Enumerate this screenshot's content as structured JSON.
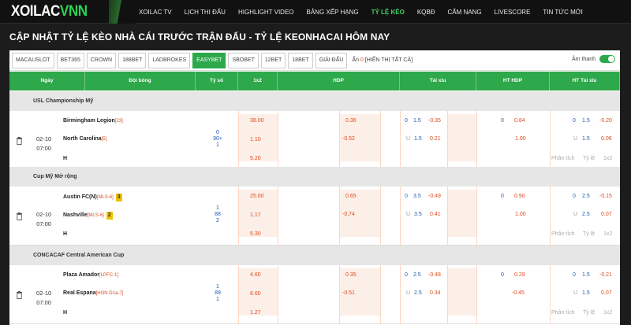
{
  "site": {
    "logo_main": "XOILAC",
    "logo_accent": "VNN"
  },
  "nav": [
    {
      "label": "XOILAC TV",
      "active": false
    },
    {
      "label": "LỊCH THI ĐẤU",
      "active": false
    },
    {
      "label": "HIGHLIGHT VIDEO",
      "active": false
    },
    {
      "label": "BẢNG XẾP HẠNG",
      "active": false
    },
    {
      "label": "TỶ LỆ KÈO",
      "active": true
    },
    {
      "label": "KQBĐ",
      "active": false
    },
    {
      "label": "CẨM NANG",
      "active": false
    },
    {
      "label": "LIVESCORE",
      "active": false
    },
    {
      "label": "TIN TỨC MỚI",
      "active": false
    }
  ],
  "page_title": "CẬP NHẬT TỶ LỆ KÈO NHÀ CÁI TRƯỚC TRẬN ĐẤU - TỶ LỆ KEONHACAI HÔM NAY",
  "bookmaker_tabs": [
    {
      "label": "MACAUSLOT",
      "active": false
    },
    {
      "label": "BET365",
      "active": false
    },
    {
      "label": "CROWN",
      "active": false
    },
    {
      "label": "188BET",
      "active": false
    },
    {
      "label": "LADBROKES",
      "active": false
    },
    {
      "label": "EASYBET",
      "active": true
    },
    {
      "label": "SBOBET",
      "active": false
    },
    {
      "label": "12BET",
      "active": false
    },
    {
      "label": "18BET",
      "active": false
    },
    {
      "label": "GIẢI ĐẤU",
      "active": false
    }
  ],
  "hidden": {
    "label": "Ẩn",
    "count": "0",
    "show_all": "[HIỂN THỊ TẤT CẢ]"
  },
  "sound": {
    "label": "Âm thanh",
    "enabled": true
  },
  "columns": [
    "Ngày",
    "Đội bóng",
    "Tỷ số",
    "1x2",
    "HDP",
    "Tài xỉu",
    "HT HDP",
    "HT Tài xỉu"
  ],
  "colors": {
    "accent": "#2da84a",
    "odds_red": "#e04b1d",
    "odds_blue": "#1e5db5",
    "header_bg": "#111111"
  },
  "matches": [
    {
      "league": "USL Championship Mỹ",
      "date": "02-10",
      "time": "07:00",
      "home": {
        "name": "Birmingham Legion",
        "rank": "[23]",
        "badge": ""
      },
      "away": {
        "name": "North Carolina",
        "rank": "[5]",
        "badge": ""
      },
      "draw_label": "H",
      "score": [
        "0",
        "90+",
        "1"
      ],
      "x12": [
        "38.00",
        "1.10",
        "5.20"
      ],
      "hdp": {
        "home_odds": "0.36",
        "away_line": "-0.52",
        "away_odds": ""
      },
      "ou": {
        "line1_label": "0",
        "line1": "1.5",
        "over": "-0.35",
        "line2_label": "U",
        "line2": "1.5",
        "under": "0.21"
      },
      "ht_hdp": {
        "line": "0",
        "home": "0.84",
        "away": "1.00"
      },
      "ht_ou": {
        "l1": "0",
        "v1": "1.5",
        "o": "-0.20",
        "l2": "U",
        "v2": "1.5",
        "u": "0.06"
      },
      "links": [
        "Phân tích",
        "Tỷ lệ",
        "1x2"
      ]
    },
    {
      "league": "Cup Mỹ Mở rộng",
      "date": "02-10",
      "time": "07:00",
      "home": {
        "name": "Austin FC(N)",
        "rank": "[MLS-6]",
        "badge": "3"
      },
      "away": {
        "name": "Nashville",
        "rank": "[MLS-6]",
        "badge": "2"
      },
      "draw_label": "H",
      "score": [
        "1",
        "88",
        "2"
      ],
      "x12": [
        "25.00",
        "1.17",
        "5.30"
      ],
      "hdp": {
        "home_odds": "0.65",
        "away_line": "-0.74",
        "away_odds": ""
      },
      "ou": {
        "line1_label": "0",
        "line1": "3.5",
        "over": "-0.49",
        "line2_label": "U",
        "line2": "3.5",
        "under": "0.41"
      },
      "ht_hdp": {
        "line": "0",
        "home": "0.90",
        "away": "1.00"
      },
      "ht_ou": {
        "l1": "0",
        "v1": "2.5",
        "o": "-0.15",
        "l2": "U",
        "v2": "2.5",
        "u": "0.07"
      },
      "links": [
        "Phân tích",
        "Tỷ lệ",
        "1x2"
      ]
    },
    {
      "league": "CONCACAF Central American Cup",
      "date": "02-10",
      "time": "07:00",
      "home": {
        "name": "Plaza Amador",
        "rank": "[LPFC-1]",
        "badge": ""
      },
      "away": {
        "name": "Real Espana",
        "rank": "[HON D1a-7]",
        "badge": ""
      },
      "draw_label": "H",
      "score": [
        "1",
        "89",
        "1"
      ],
      "x12": [
        "4.60",
        "8.60",
        "1.27"
      ],
      "hdp": {
        "home_odds": "0.35",
        "away_line": "-0.51",
        "away_odds": ""
      },
      "ou": {
        "line1_label": "0",
        "line1": "2.5",
        "over": "-0.48",
        "line2_label": "U",
        "line2": "2.5",
        "under": "0.34"
      },
      "ht_hdp": {
        "line": "0",
        "home": "0.29",
        "away": "-0.45"
      },
      "ht_ou": {
        "l1": "0",
        "v1": "1.5",
        "o": "-0.21",
        "l2": "U",
        "v2": "1.5",
        "u": "0.07"
      },
      "links": [
        "Phân tích",
        "Tỷ lệ",
        "1x2"
      ]
    }
  ]
}
